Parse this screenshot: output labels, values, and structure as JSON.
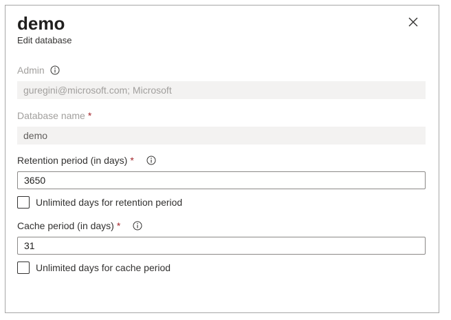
{
  "header": {
    "title": "demo",
    "subtitle": "Edit database"
  },
  "admin": {
    "label": "Admin",
    "value": "guregini@microsoft.com; Microsoft"
  },
  "database_name": {
    "label": "Database name",
    "required": "*",
    "value": "demo"
  },
  "retention": {
    "label": "Retention period (in days)",
    "required": "*",
    "value": "3650",
    "unlimited_label": "Unlimited days for retention period"
  },
  "cache": {
    "label": "Cache period (in days)",
    "required": "*",
    "value": "31",
    "unlimited_label": "Unlimited days for cache period"
  },
  "colors": {
    "required": "#a4262c",
    "disabled_text": "#a19f9d",
    "disabled_bg": "#f3f2f1",
    "border": "#8a8886"
  },
  "icons": [
    "close-icon",
    "info-icon"
  ]
}
